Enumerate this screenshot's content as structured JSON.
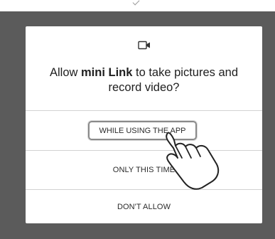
{
  "dialog": {
    "title_prefix": "Allow ",
    "title_app": "mini Link",
    "title_suffix": " to take pictures and record video?",
    "icon": "video-camera-icon",
    "options": [
      {
        "label": "WHILE USING THE APP"
      },
      {
        "label": "ONLY THIS TIME"
      },
      {
        "label": "DON'T ALLOW"
      }
    ]
  },
  "overlay": {
    "pointer": "hand-pointer-icon"
  },
  "colors": {
    "scrim": "#5b5b5b",
    "dialog_bg": "#ffffff",
    "divider": "#d2d2d2",
    "text": "#202020",
    "highlight_border": "#8a8a8a"
  }
}
